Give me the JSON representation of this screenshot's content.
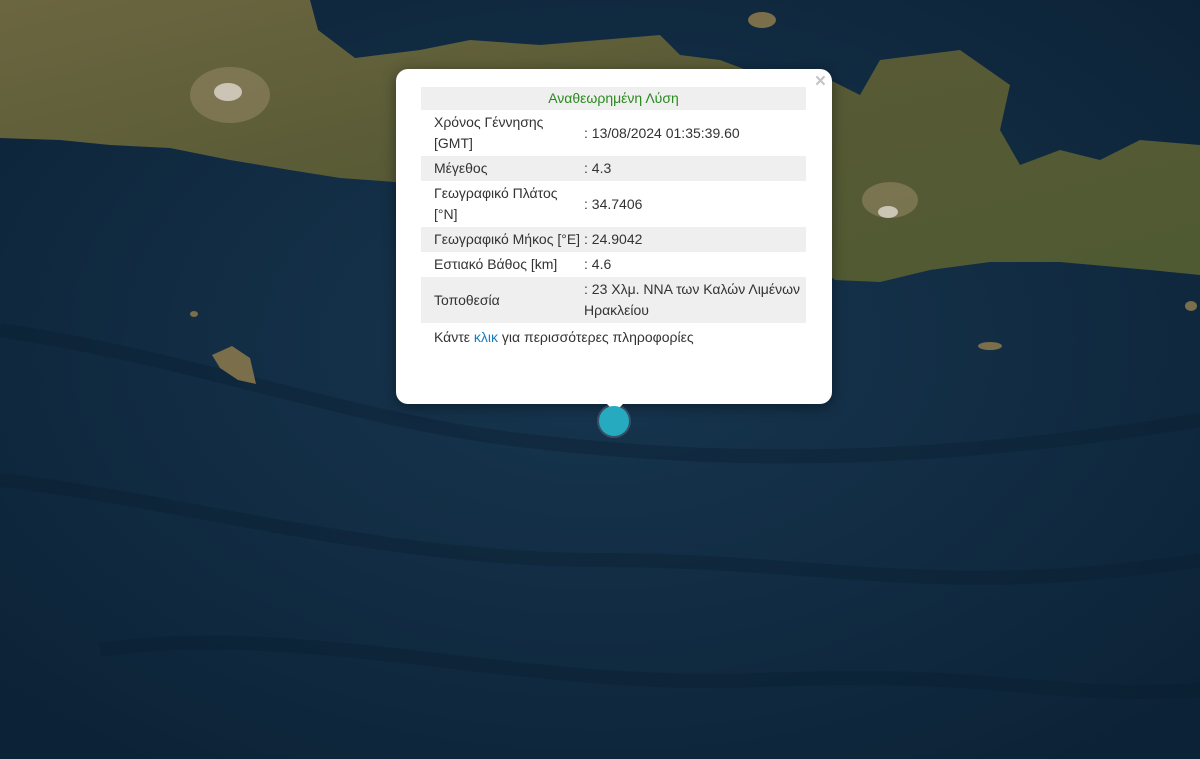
{
  "map": {
    "basemap": "satellite",
    "colors": {
      "sea": "#0f2a40",
      "land": "#5d5a36",
      "marker": "#26aabf"
    }
  },
  "popup": {
    "title": "Αναθεωρημένη Λύση",
    "close_icon": "×",
    "rows": [
      {
        "label": "Χρόνος Γέννησης [GMT]",
        "value": ": 13/08/2024 01:35:39.60"
      },
      {
        "label": "Μέγεθος",
        "value": ": 4.3"
      },
      {
        "label": "Γεωγραφικό Πλάτος [°N]",
        "value": ": 34.7406"
      },
      {
        "label": "Γεωγραφικό Μήκος [°E]",
        "value": ": 24.9042"
      },
      {
        "label": "Εστιακό Βάθος [km]",
        "value": ": 4.6"
      },
      {
        "label": "Τοποθεσία",
        "value": ": 23 Χλμ. ΝΝΑ των Καλών Λιμένων Ηρακλείου"
      }
    ],
    "footer": {
      "prefix": "Κάντε ",
      "link": "κλικ",
      "suffix": " για περισσότερες πληροφορίες"
    },
    "title_color": "#2a8a1f",
    "link_color": "#1a7dc0"
  },
  "marker": {
    "icon": "epicenter-marker-icon"
  }
}
